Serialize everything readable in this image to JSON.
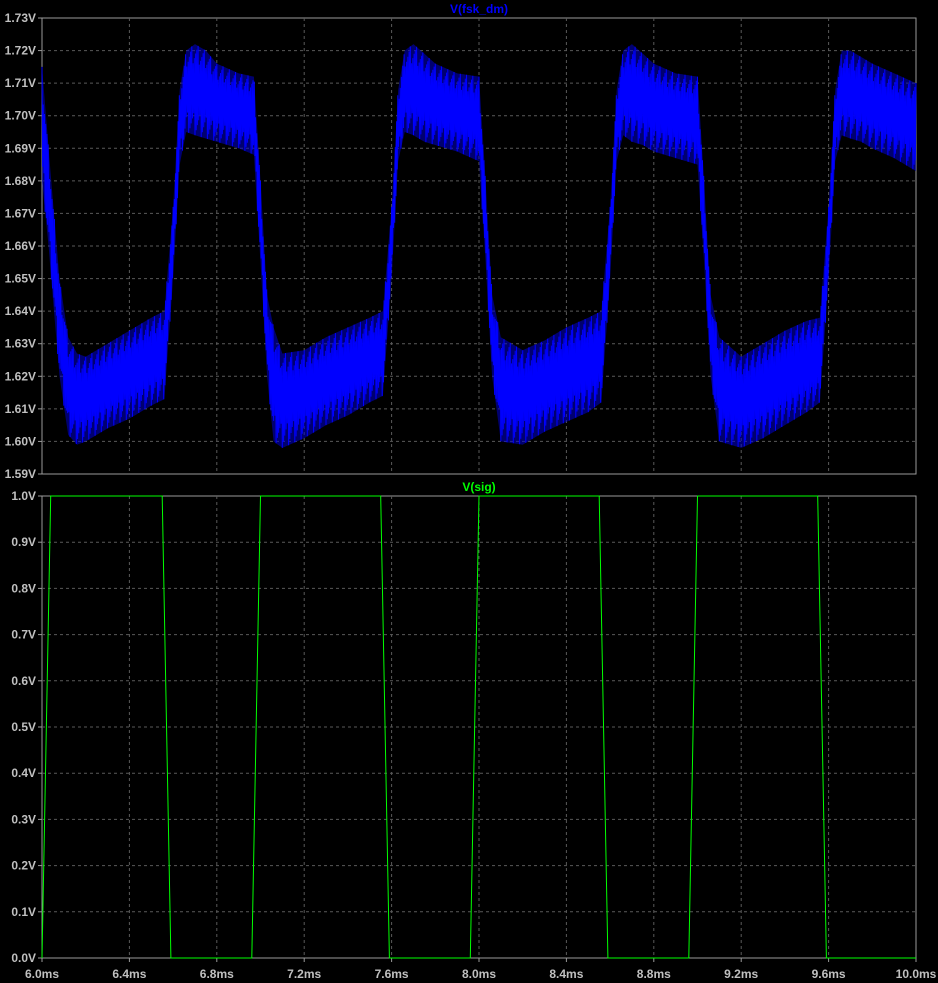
{
  "chart_data": [
    {
      "type": "line",
      "title": "V(fsk_dm)",
      "color": "#0000ff",
      "xlim": [
        6.0,
        10.0
      ],
      "ylim": [
        1.59,
        1.73
      ],
      "y_ticks": [
        "1.73V",
        "1.72V",
        "1.71V",
        "1.70V",
        "1.69V",
        "1.68V",
        "1.67V",
        "1.66V",
        "1.65V",
        "1.64V",
        "1.63V",
        "1.62V",
        "1.61V",
        "1.60V",
        "1.59V"
      ],
      "grid": true,
      "envelope": {
        "note_unit": "ms / V",
        "x": [
          6.0,
          6.03,
          6.08,
          6.12,
          6.16,
          6.2,
          6.3,
          6.4,
          6.5,
          6.56,
          6.6,
          6.63,
          6.66,
          6.7,
          6.75,
          6.8,
          6.9,
          6.97,
          7.0,
          7.03,
          7.06,
          7.1,
          7.2,
          7.3,
          7.4,
          7.5,
          7.56,
          7.6,
          7.63,
          7.66,
          7.7,
          7.75,
          7.8,
          7.9,
          8.0,
          8.03,
          8.06,
          8.1,
          8.2,
          8.3,
          8.4,
          8.5,
          8.56,
          8.6,
          8.63,
          8.66,
          8.7,
          8.75,
          8.8,
          8.9,
          9.0,
          9.03,
          9.06,
          9.1,
          9.2,
          9.3,
          9.4,
          9.5,
          9.56,
          9.6,
          9.63,
          9.66,
          9.7,
          9.75,
          9.8,
          9.9,
          10.0
        ],
        "upper": [
          1.715,
          1.69,
          1.65,
          1.632,
          1.627,
          1.626,
          1.63,
          1.634,
          1.638,
          1.64,
          1.672,
          1.708,
          1.72,
          1.722,
          1.72,
          1.716,
          1.713,
          1.712,
          1.68,
          1.645,
          1.635,
          1.627,
          1.628,
          1.632,
          1.635,
          1.638,
          1.64,
          1.672,
          1.708,
          1.72,
          1.722,
          1.719,
          1.716,
          1.713,
          1.712,
          1.68,
          1.645,
          1.632,
          1.628,
          1.631,
          1.635,
          1.638,
          1.64,
          1.672,
          1.708,
          1.72,
          1.722,
          1.719,
          1.716,
          1.713,
          1.712,
          1.68,
          1.645,
          1.632,
          1.626,
          1.63,
          1.634,
          1.637,
          1.638,
          1.672,
          1.708,
          1.72,
          1.72,
          1.718,
          1.716,
          1.713,
          1.71
        ],
        "lower": [
          1.68,
          1.66,
          1.62,
          1.602,
          1.599,
          1.6,
          1.604,
          1.607,
          1.611,
          1.613,
          1.65,
          1.685,
          1.695,
          1.694,
          1.693,
          1.692,
          1.69,
          1.688,
          1.655,
          1.62,
          1.6,
          1.598,
          1.601,
          1.605,
          1.608,
          1.612,
          1.614,
          1.65,
          1.686,
          1.695,
          1.694,
          1.692,
          1.691,
          1.689,
          1.686,
          1.655,
          1.62,
          1.6,
          1.599,
          1.603,
          1.606,
          1.609,
          1.612,
          1.65,
          1.686,
          1.694,
          1.692,
          1.691,
          1.689,
          1.687,
          1.685,
          1.655,
          1.62,
          1.6,
          1.598,
          1.601,
          1.605,
          1.609,
          1.612,
          1.65,
          1.686,
          1.694,
          1.693,
          1.692,
          1.69,
          1.687,
          1.683
        ]
      }
    },
    {
      "type": "line",
      "title": "V(sig)",
      "color": "#00ff00",
      "xlim": [
        6.0,
        10.0
      ],
      "ylim": [
        0.0,
        1.0
      ],
      "y_ticks": [
        "1.0V",
        "0.9V",
        "0.8V",
        "0.7V",
        "0.6V",
        "0.5V",
        "0.4V",
        "0.3V",
        "0.2V",
        "0.1V",
        "0.0V"
      ],
      "x_ticks": [
        "6.0ms",
        "6.4ms",
        "6.8ms",
        "7.2ms",
        "7.6ms",
        "8.0ms",
        "8.4ms",
        "8.8ms",
        "9.2ms",
        "9.6ms",
        "10.0ms"
      ],
      "grid": true,
      "x": [
        6.0,
        6.04,
        6.55,
        6.59,
        6.96,
        7.0,
        7.55,
        7.59,
        7.96,
        8.0,
        8.55,
        8.59,
        8.96,
        9.0,
        9.55,
        9.59,
        10.0
      ],
      "y": [
        0.0,
        1.0,
        1.0,
        0.0,
        0.0,
        1.0,
        1.0,
        0.0,
        0.0,
        1.0,
        1.0,
        0.0,
        0.0,
        1.0,
        1.0,
        0.0,
        0.0
      ]
    }
  ]
}
